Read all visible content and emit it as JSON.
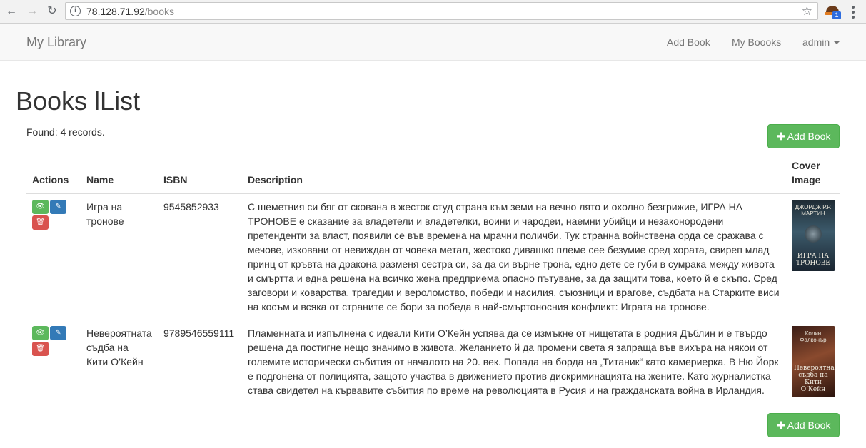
{
  "browser": {
    "url_host": "78.128.71.92",
    "url_path": "/books",
    "ext_badge": "1"
  },
  "navbar": {
    "brand": "My Library",
    "links": [
      "Add Book",
      "My Boooks"
    ],
    "user": "admin"
  },
  "page": {
    "title": "Books lList",
    "found": "Found: 4 records.",
    "add_button": "Add Book"
  },
  "table": {
    "headers": {
      "actions": "Actions",
      "name": "Name",
      "isbn": "ISBN",
      "description": "Description",
      "cover": "Cover Image"
    },
    "rows": [
      {
        "name": "Игра на тронове",
        "isbn": "9545852933",
        "description": "С шеметния си бяг от скована в жесток студ страна към земи на вечно лято и охолно безгрижие, ИГРА НА ТРОНОВЕ е сказание за владетели и владетелки, воини и чародеи, наемни убийци и незаконородени претенденти за власт, появили се във времена на мрачни поличби. Тук странна войнствена орда се сражава с мечове, изковани от невиждан от човека метал, жестоко дивашко племе сее безумие сред хората, свиреп млад принц от кръвта на дракона разменя сестра си, за да си върне трона, едно дете се губи в сумрака между живота и смъртта и една решена на всичко жена предприема опасно пътуване, за да защити това, което й е скъпо. Сред заговори и коварства, трагедии и вероломство, победи и насилия, съюзници и врагове, съдбата на Старките виси на косъм и всяка от страните се бори за победа в най-смъртоносния конфликт: Играта на тронове.",
        "cover_author": "ДЖОРДЖ Р.Р. МАРТИН",
        "cover_title": "ИГРА НА ТРОНОВЕ"
      },
      {
        "name": "Невероятната съдба на Кити О’Кейн",
        "isbn": "9789546559111",
        "description": "Пламенната и изпълнена с идеали Кити О’Кейн успява да се измъкне от нищетата в родния Дъблин и е твърдо решена да постигне нещо значимо в живота. Желанието й да промени света я запраща във вихъра на някои от големите исторически събития от началото на 20. век. Попада на борда на „Титаник“ като камериерка. В Ню Йорк е подгонена от полицията, защото участва в движението против дискриминацията на жените. Като журналистка става свидетел на кървавите събития по време на революцията в Русия и на гражданската война в Ирландия.",
        "cover_author": "Колин Фалконър",
        "cover_title": "Невероятната съдба на Кити О’Кейн"
      }
    ]
  },
  "colors": {
    "success": "#5cb85c",
    "primary": "#337ab7",
    "danger": "#d9534f"
  }
}
